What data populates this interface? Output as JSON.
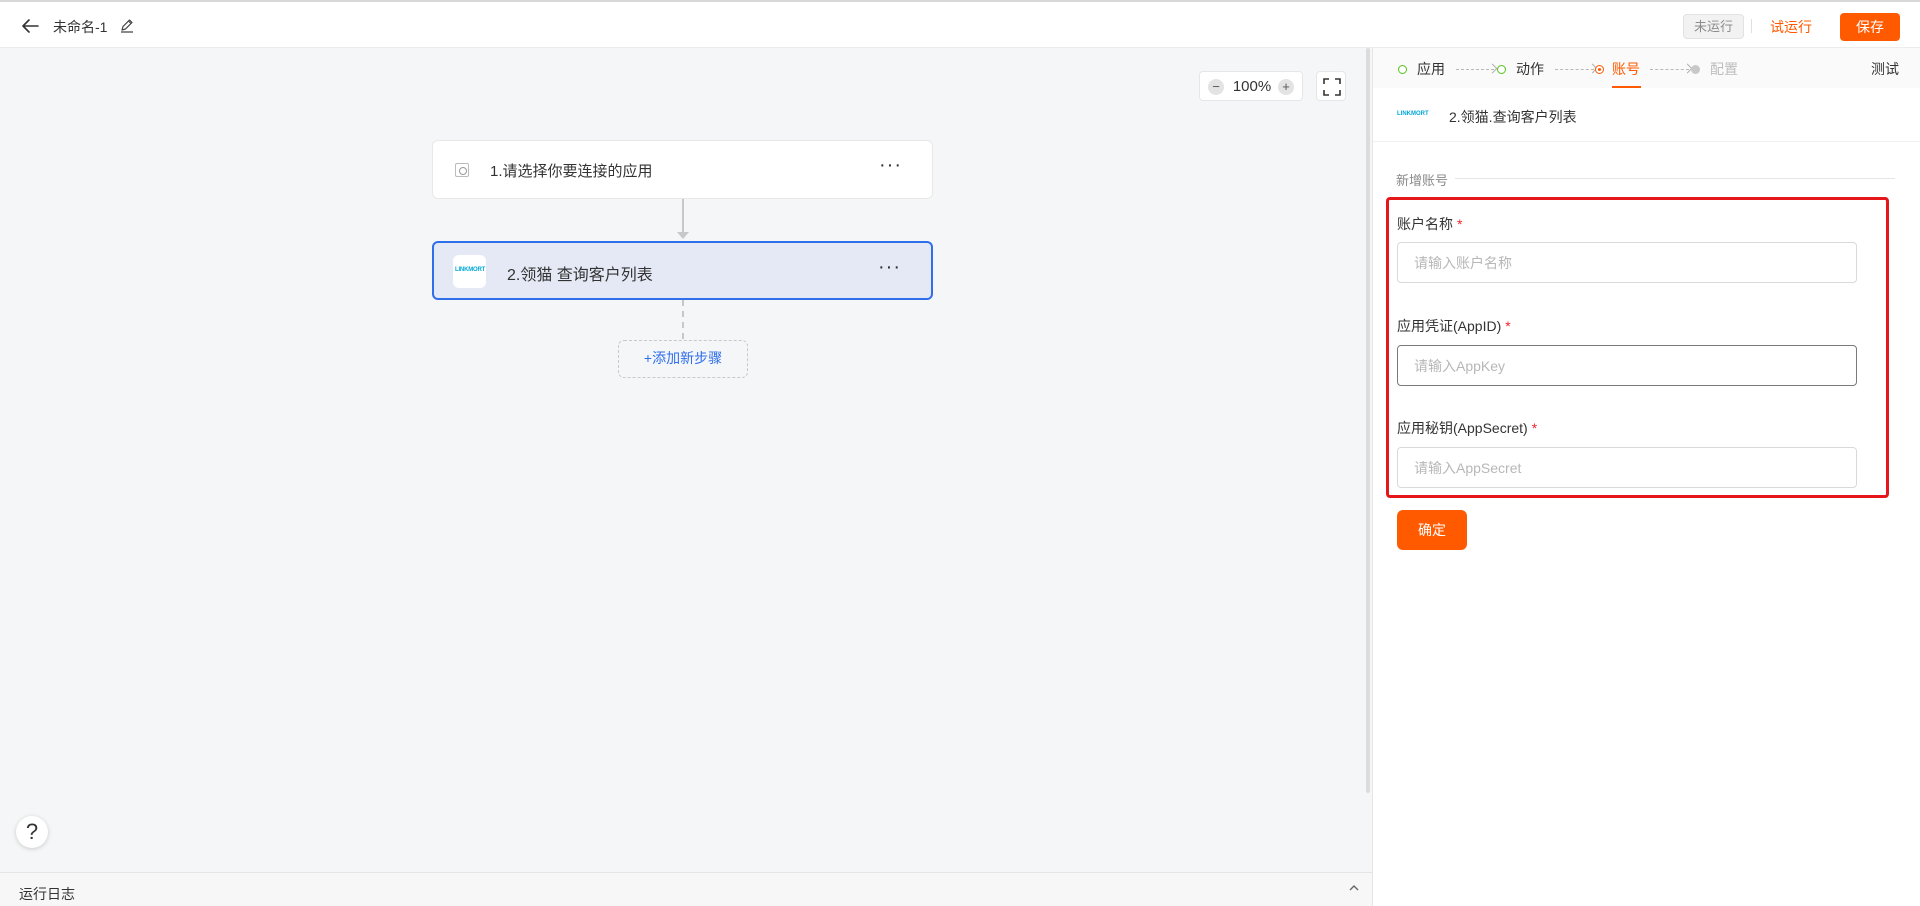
{
  "header": {
    "title": "未命名-1",
    "status": "未运行",
    "test_run_label": "试运行",
    "save_label": "保存"
  },
  "canvas": {
    "zoom": "100%",
    "zoom_out_symbol": "−",
    "zoom_in_symbol": "+",
    "nodes": [
      {
        "label": "1.请选择你要连接的应用",
        "menu": "···"
      },
      {
        "label": "2.领猫 查询客户列表",
        "menu": "···",
        "logo": "LINKMORT"
      }
    ],
    "add_step_label": "+添加新步骤",
    "help_symbol": "?"
  },
  "log": {
    "label": "运行日志"
  },
  "panel": {
    "steps": [
      {
        "label": "应用",
        "state": "done"
      },
      {
        "label": "动作",
        "state": "done"
      },
      {
        "label": "账号",
        "state": "active"
      },
      {
        "label": "配置",
        "state": "pending"
      }
    ],
    "test_tab": "测试",
    "app_logo": "LINKMORT",
    "app_title": "2.领猫.查询客户列表",
    "section_title": "新增账号",
    "fields": [
      {
        "label": "账户名称",
        "required": "*",
        "placeholder": "请输入账户名称",
        "value": ""
      },
      {
        "label": "应用凭证(AppID)",
        "required": "*",
        "placeholder": "请输入AppKey",
        "value": ""
      },
      {
        "label": "应用秘钥(AppSecret)",
        "required": "*",
        "placeholder": "请输入AppSecret",
        "value": ""
      }
    ],
    "confirm_label": "确定"
  },
  "colors": {
    "accent": "#ff5a00",
    "selected_node_border": "#2f6fec",
    "highlight_border": "#e5171b",
    "step_done": "#52c41a"
  }
}
